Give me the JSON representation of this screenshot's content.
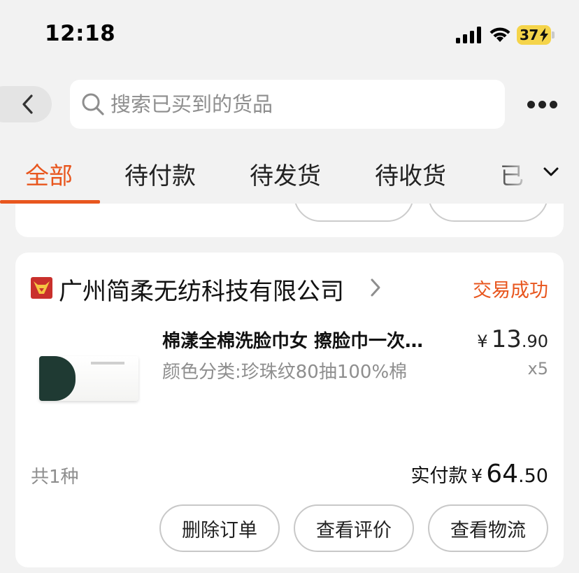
{
  "status_bar": {
    "time": "12:18",
    "battery": "37",
    "accent_battery": "#f5d44a"
  },
  "header": {
    "back_icon": "chevron-left-icon",
    "search_placeholder": "搜索已买到的货品",
    "search_icon": "search-icon",
    "more_icon": "more-horizontal-icon"
  },
  "tabs": {
    "items": [
      {
        "label": "全部",
        "active": true
      },
      {
        "label": "待付款",
        "active": false
      },
      {
        "label": "待发货",
        "active": false
      },
      {
        "label": "待收货",
        "active": false
      },
      {
        "label": "已",
        "active": false
      }
    ],
    "expand_icon": "chevron-down-icon",
    "accent": "#e8561e"
  },
  "order": {
    "shop_name": "广州简柔无纺科技有限公司",
    "status": "交易成功",
    "product": {
      "title": "棉漾全棉洗脸巾女 擦脸巾一次…",
      "sku": "颜色分类:珍珠纹80抽100%棉",
      "price_currency": "¥",
      "price_int": "13",
      "price_dec": ".90",
      "quantity": "x5"
    },
    "item_count": "共1种",
    "total_label": "实付款",
    "total_currency": "¥",
    "total_int": "64",
    "total_dec": ".50",
    "actions": {
      "delete": "删除订单",
      "review": "查看评价",
      "logistics": "查看物流"
    }
  }
}
